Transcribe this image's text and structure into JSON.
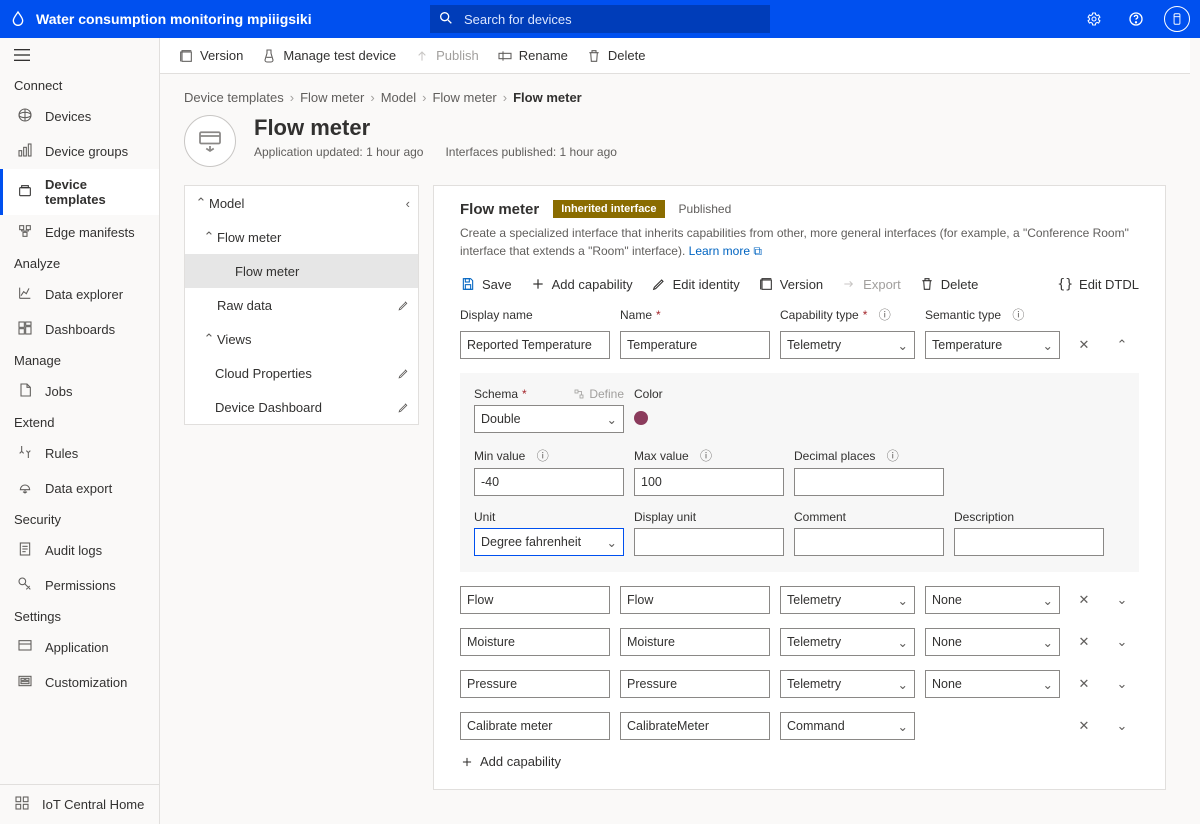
{
  "app": {
    "name": "Water consumption monitoring mpiiigsiki",
    "search_placeholder": "Search for devices"
  },
  "sidebar": {
    "groups": [
      {
        "label": "Connect",
        "items": [
          {
            "id": "devices",
            "label": "Devices",
            "icon": "devices-icon"
          },
          {
            "id": "device-groups",
            "label": "Device groups",
            "icon": "device-groups-icon"
          },
          {
            "id": "device-templates",
            "label": "Device templates",
            "icon": "template-icon",
            "selected": true
          },
          {
            "id": "edge-manifests",
            "label": "Edge manifests",
            "icon": "edge-icon"
          }
        ]
      },
      {
        "label": "Analyze",
        "items": [
          {
            "id": "data-explorer",
            "label": "Data explorer",
            "icon": "chart-icon"
          },
          {
            "id": "dashboards",
            "label": "Dashboards",
            "icon": "dashboard-icon"
          }
        ]
      },
      {
        "label": "Manage",
        "items": [
          {
            "id": "jobs",
            "label": "Jobs",
            "icon": "jobs-icon"
          }
        ]
      },
      {
        "label": "Extend",
        "items": [
          {
            "id": "rules",
            "label": "Rules",
            "icon": "rules-icon"
          },
          {
            "id": "data-export",
            "label": "Data export",
            "icon": "export-icon"
          }
        ]
      },
      {
        "label": "Security",
        "items": [
          {
            "id": "audit-logs",
            "label": "Audit logs",
            "icon": "audit-icon"
          },
          {
            "id": "permissions",
            "label": "Permissions",
            "icon": "permissions-icon"
          }
        ]
      },
      {
        "label": "Settings",
        "items": [
          {
            "id": "application",
            "label": "Application",
            "icon": "app-settings-icon"
          },
          {
            "id": "customization",
            "label": "Customization",
            "icon": "customize-icon"
          }
        ]
      }
    ],
    "footer": {
      "label": "IoT Central Home"
    }
  },
  "commandBar": {
    "version": "Version",
    "manage": "Manage test device",
    "publish": "Publish",
    "rename": "Rename",
    "delete": "Delete"
  },
  "breadcrumbs": [
    "Device templates",
    "Flow meter",
    "Model",
    "Flow meter",
    "Flow meter"
  ],
  "page": {
    "title": "Flow meter",
    "updated": "Application updated: 1 hour ago",
    "interfaces": "Interfaces published: 1 hour ago"
  },
  "tree": {
    "model": "Model",
    "flowmeter_parent": "Flow meter",
    "flowmeter_child": "Flow meter",
    "raw_data": "Raw data",
    "views": "Views",
    "cloud_props": "Cloud Properties",
    "device_dash": "Device Dashboard"
  },
  "detail": {
    "title": "Flow meter",
    "badge": "Inherited interface",
    "published": "Published",
    "desc_a": "Create a specialized interface that inherits capabilities from other, more general interfaces (for example, a \"Conference Room\" interface that extends a \"Room\" interface). ",
    "learn_more": "Learn more",
    "cmds": {
      "save": "Save",
      "add": "Add capability",
      "edit": "Edit identity",
      "version": "Version",
      "export": "Export",
      "delete": "Delete",
      "editdtdl": "Edit DTDL"
    },
    "labels": {
      "display_name": "Display name",
      "name": "Name",
      "cap_type": "Capability type",
      "semantic_type": "Semantic type",
      "schema": "Schema",
      "define": "Define",
      "color": "Color",
      "min": "Min value",
      "max": "Max value",
      "decimal": "Decimal places",
      "unit": "Unit",
      "display_unit": "Display unit",
      "comment": "Comment",
      "description": "Description",
      "add_capability": "Add capability"
    },
    "expanded": {
      "display_name": "Reported Temperature",
      "name": "Temperature",
      "cap_type": "Telemetry",
      "semantic_type": "Temperature",
      "schema": "Double",
      "min": "-40",
      "max": "100",
      "decimal": "",
      "unit": "Degree fahrenheit",
      "display_unit": "",
      "comment": "",
      "description": "",
      "color": "#8b3b5c"
    },
    "rows": [
      {
        "display": "Flow",
        "name": "Flow",
        "type": "Telemetry",
        "sem": "None"
      },
      {
        "display": "Moisture",
        "name": "Moisture",
        "type": "Telemetry",
        "sem": "None"
      },
      {
        "display": "Pressure",
        "name": "Pressure",
        "type": "Telemetry",
        "sem": "None"
      },
      {
        "display": "Calibrate meter",
        "name": "CalibrateMeter",
        "type": "Command",
        "sem": "",
        "squiggle": true
      }
    ]
  }
}
